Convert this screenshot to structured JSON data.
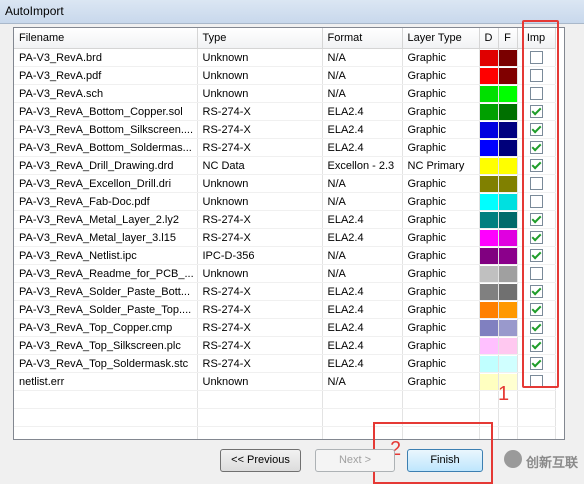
{
  "window": {
    "title": "AutoImport"
  },
  "columns": {
    "filename": "Filename",
    "type": "Type",
    "format": "Format",
    "layer_type": "Layer Type",
    "d": "D",
    "f": "F",
    "imp": "Imp"
  },
  "rows": [
    {
      "filename": "PA-V3_RevA.brd",
      "type": "Unknown",
      "format": "N/A",
      "layer_type": "Graphic",
      "d": "#e00000",
      "f": "#7a0000",
      "imp": false
    },
    {
      "filename": "PA-V3_RevA.pdf",
      "type": "Unknown",
      "format": "N/A",
      "layer_type": "Graphic",
      "d": "#ff0000",
      "f": "#800000",
      "imp": false
    },
    {
      "filename": "PA-V3_RevA.sch",
      "type": "Unknown",
      "format": "N/A",
      "layer_type": "Graphic",
      "d": "#00e000",
      "f": "#00ff00",
      "imp": false
    },
    {
      "filename": "PA-V3_RevA_Bottom_Copper.sol",
      "type": "RS-274-X",
      "format": "ELA2.4",
      "layer_type": "Graphic",
      "d": "#00a000",
      "f": "#007000",
      "imp": true
    },
    {
      "filename": "PA-V3_RevA_Bottom_Silkscreen....",
      "type": "RS-274-X",
      "format": "ELA2.4",
      "layer_type": "Graphic",
      "d": "#0000e0",
      "f": "#000080",
      "imp": true
    },
    {
      "filename": "PA-V3_RevA_Bottom_Soldermas...",
      "type": "RS-274-X",
      "format": "ELA2.4",
      "layer_type": "Graphic",
      "d": "#0000ff",
      "f": "#00007a",
      "imp": true
    },
    {
      "filename": "PA-V3_RevA_Drill_Drawing.drd",
      "type": "NC Data",
      "format": "Excellon - 2.3",
      "layer_type": "NC Primary",
      "d": "#ffff00",
      "f": "#ffff00",
      "imp": true
    },
    {
      "filename": "PA-V3_RevA_Excellon_Drill.dri",
      "type": "Unknown",
      "format": "N/A",
      "layer_type": "Graphic",
      "d": "#808000",
      "f": "#808000",
      "imp": false
    },
    {
      "filename": "PA-V3_RevA_Fab-Doc.pdf",
      "type": "Unknown",
      "format": "N/A",
      "layer_type": "Graphic",
      "d": "#00ffff",
      "f": "#00e0e0",
      "imp": false
    },
    {
      "filename": "PA-V3_RevA_Metal_Layer_2.ly2",
      "type": "RS-274-X",
      "format": "ELA2.4",
      "layer_type": "Graphic",
      "d": "#008080",
      "f": "#006b6b",
      "imp": true
    },
    {
      "filename": "PA-V3_RevA_Metal_layer_3.l15",
      "type": "RS-274-X",
      "format": "ELA2.4",
      "layer_type": "Graphic",
      "d": "#ff00ff",
      "f": "#e000e0",
      "imp": true
    },
    {
      "filename": "PA-V3_RevA_Netlist.ipc",
      "type": "IPC-D-356",
      "format": "N/A",
      "layer_type": "Graphic",
      "d": "#800080",
      "f": "#8b008b",
      "imp": true
    },
    {
      "filename": "PA-V3_RevA_Readme_for_PCB_...",
      "type": "Unknown",
      "format": "N/A",
      "layer_type": "Graphic",
      "d": "#c0c0c0",
      "f": "#a0a0a0",
      "imp": false
    },
    {
      "filename": "PA-V3_RevA_Solder_Paste_Bott...",
      "type": "RS-274-X",
      "format": "ELA2.4",
      "layer_type": "Graphic",
      "d": "#808080",
      "f": "#707070",
      "imp": true
    },
    {
      "filename": "PA-V3_RevA_Solder_Paste_Top....",
      "type": "RS-274-X",
      "format": "ELA2.4",
      "layer_type": "Graphic",
      "d": "#ff8000",
      "f": "#ff9900",
      "imp": true
    },
    {
      "filename": "PA-V3_RevA_Top_Copper.cmp",
      "type": "RS-274-X",
      "format": "ELA2.4",
      "layer_type": "Graphic",
      "d": "#8080c0",
      "f": "#9999cc",
      "imp": true
    },
    {
      "filename": "PA-V3_RevA_Top_Silkscreen.plc",
      "type": "RS-274-X",
      "format": "ELA2.4",
      "layer_type": "Graphic",
      "d": "#ffc0ff",
      "f": "#ffc8f0",
      "imp": true
    },
    {
      "filename": "PA-V3_RevA_Top_Soldermask.stc",
      "type": "RS-274-X",
      "format": "ELA2.4",
      "layer_type": "Graphic",
      "d": "#c0ffff",
      "f": "#d0ffff",
      "imp": true
    },
    {
      "filename": "netlist.err",
      "type": "Unknown",
      "format": "N/A",
      "layer_type": "Graphic",
      "d": "#ffffc0",
      "f": "#ffffd0",
      "imp": false
    }
  ],
  "empty_rows": 3,
  "buttons": {
    "previous": "<< Previous",
    "next": "Next >",
    "finish": "Finish"
  },
  "annotations": {
    "label1": "1",
    "label2": "2"
  },
  "watermark": {
    "text": "创新互联",
    "icon": "brand-logo-icon"
  },
  "colors": {
    "highlight": "#e53935",
    "check": "#1f9d2a"
  }
}
